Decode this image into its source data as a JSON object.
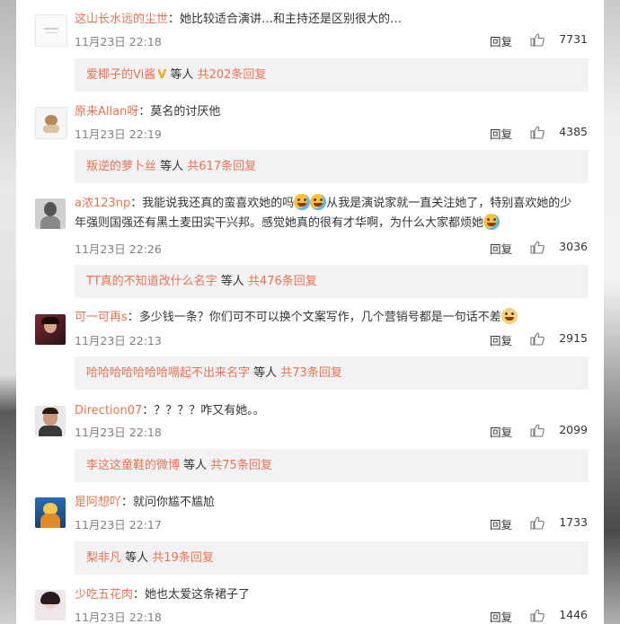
{
  "comments": [
    {
      "user": "这山长水远的尘世",
      "text": "：她比较适合演讲…和主持还是区别很大的…",
      "time": "11月23日 22:18",
      "reply_label": "回复",
      "likes": "7731",
      "reply_box": {
        "names": "爱椰子的Vi酱",
        "others": " 等人 ",
        "count": "共202条回复"
      }
    },
    {
      "user": "原来Allan呀",
      "text": "：莫名的讨厌他",
      "time": "11月23日 22:19",
      "reply_label": "回复",
      "likes": "4385",
      "reply_box": {
        "names": "叛逆的萝卜丝",
        "others": " 等人 ",
        "count": "共617条回复"
      }
    },
    {
      "user": "a浓123np",
      "text_1": "：我能说我还真的蛮喜欢她的吗",
      "text_2": "从我是演说家就一直关注她了，特别喜欢她的少年强则国强还有黑土麦田实干兴邦。感觉她真的很有才华啊，为什么大家都烦她",
      "time": "11月23日 22:26",
      "reply_label": "回复",
      "likes": "3036",
      "reply_box": {
        "names": "TT真的不知道改什么名字",
        "others": " 等人 ",
        "count": "共476条回复"
      }
    },
    {
      "user": "可一可再s",
      "text": "：多少钱一条？你们可不可以换个文案写作，几个营销号都是一句话不差",
      "time": "11月23日 22:13",
      "reply_label": "回复",
      "likes": "2915",
      "reply_box": {
        "names": "哈哈哈哈哈哈哈嗝起不出来名字",
        "others": " 等人 ",
        "count": "共73条回复"
      }
    },
    {
      "user": "Direction07",
      "text": "：？？？？咋又有她。。",
      "time": "11月23日 22:18",
      "reply_label": "回复",
      "likes": "2099",
      "reply_box": {
        "names": "李这这童鞋的微博",
        "others": " 等人 ",
        "count": "共75条回复"
      }
    },
    {
      "user": "是阿想吖",
      "text": "：就问你尴不尴尬",
      "time": "11月23日 22:17",
      "reply_label": "回复",
      "likes": "1733",
      "reply_box": {
        "names": "梨非凡",
        "others": " 等人 ",
        "count": "共19条回复"
      }
    },
    {
      "user": "少吃五花肉",
      "text": "：她也太爱这条裙子了",
      "time": "11月23日 22:18",
      "reply_label": "回复",
      "likes": "1446"
    }
  ],
  "colors": {
    "username": "#eb7350",
    "text": "#333333",
    "meta": "#808080",
    "reply_bg": "#f2f2f5",
    "badge": "#f0a81a"
  },
  "icons": {
    "like": "thumbs-up-icon",
    "badge": "vip-v-icon",
    "emoji_laugh": "laughing-tears-emoji",
    "emoji_dog": "dog-face-emoji"
  }
}
